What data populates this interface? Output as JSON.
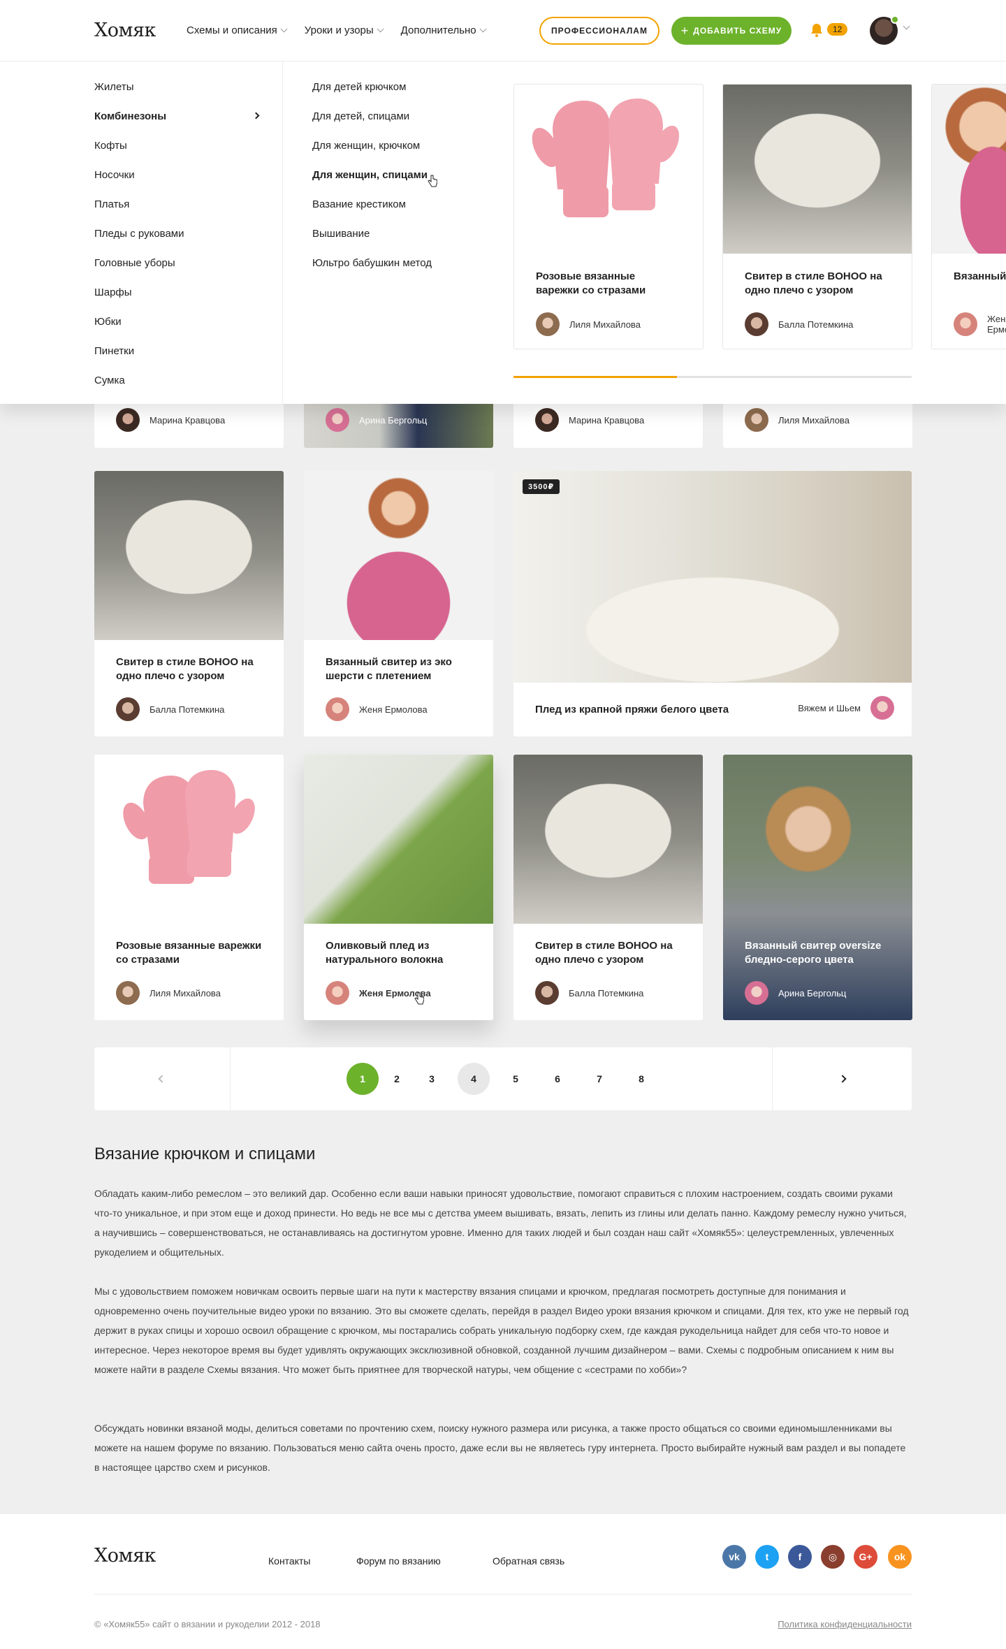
{
  "header": {
    "logo": "Хомяк",
    "nav": [
      "Схемы и описания",
      "Уроки и узоры",
      "Дополнительно"
    ],
    "btn_pro": "ПРОФЕССИОНАЛАМ",
    "btn_add": "ДОБАВИТЬ СХЕМУ",
    "notifications_count": "12"
  },
  "mega_menu": {
    "categories": [
      "Жилеты",
      "Комбинезоны",
      "Кофты",
      "Носочки",
      "Платья",
      "Пледы с руковами",
      "Головные уборы",
      "Шарфы",
      "Юбки",
      "Пинетки",
      "Сумка"
    ],
    "active_category": "Комбинезоны",
    "subcategories": [
      "Для детей крючком",
      "Для детей, спицами",
      "Для женщин, крючком",
      "Для женщин, спицами",
      "Вазание крестиком",
      "Вышивание",
      "Юльтро бабушкин метод"
    ],
    "active_subcategory": "Для женщин, спицами",
    "cards": [
      {
        "title": "Розовые вязанные варежки со стразами",
        "author": "Лиля Михайлова"
      },
      {
        "title": "Свитер в стиле BOHOO на одно плечо с узором",
        "author": "Балла Потемкина"
      },
      {
        "title": "Вязанный свитер из эко шерсти с",
        "author": "Женя Ермолова"
      }
    ],
    "scroll_progress": 0.41
  },
  "row1_authors": [
    "Марина Кравцова",
    "Арина Бергольц",
    "Марина Кравцова",
    "Лиля Михайлова"
  ],
  "row2": [
    {
      "title": "Свитер в стиле BOHOO на одно плечо с узором",
      "author": "Балла Потемкина"
    },
    {
      "title": "Вязанный свитер из эко шерсти с плетением",
      "author": "Женя Ермолова"
    },
    {
      "title": "Плед из крапной пряжи белого цвета",
      "author": "Вяжем и Шьем",
      "price": "3500₽"
    }
  ],
  "row3": [
    {
      "title": "Розовые вязанные варежки со стразами",
      "author": "Лиля Михайлова"
    },
    {
      "title": "Оливковый плед из натурального волокна",
      "author": "Женя Ермолова"
    },
    {
      "title": "Свитер в стиле BOHOO на одно плечо с узором",
      "author": "Балла Потемкина"
    },
    {
      "title": "Вязанный свитер oversize бледно-серого цвета",
      "author": "Арина Бергольц"
    }
  ],
  "pagination": {
    "pages": [
      "1",
      "2",
      "3",
      "4",
      "5",
      "6",
      "7",
      "8"
    ],
    "current": "1",
    "hovered": "4"
  },
  "seo": {
    "title": "Вязание крючком и спицами",
    "p1": "Обладать каким-либо ремеслом – это великий дар. Особенно если ваши навыки приносят удовольствие, помогают справиться с плохим настроением, создать своими руками что-то уникальное, и при этом еще и доход принести. Но ведь не все мы с детства умеем вышивать, вязать, лепить из глины или делать панно. Каждому ремеслу нужно учиться, а научившись – совершенствоваться, не останавливаясь на достигнутом уровне. Именно для таких людей и был создан наш сайт «Хомяк55»: целеустремленных, увлеченных рукоделием и общительных.",
    "p2": "Мы с удовольствием поможем новичкам освоить первые шаги на пути к мастерству вязания спицами и крючком, предлагая посмотреть доступные для понимания и одновременно очень поучительные видео уроки по вязанию. Это вы сможете сделать, перейдя в раздел Видео уроки вязания крючком и спицами. Для тех, кто уже не первый год держит в руках спицы и хорошо освоил обращение с крючком, мы постарались собрать уникальную подборку схем, где каждая рукодельница найдет для себя что-то новое и интересное. Через некоторое время вы будет удивлять окружающих эксклюзивной обновкой, созданной лучшим дизайнером – вами. Схемы с подробным описанием к ним вы можете найти в разделе Схемы вязания. Что может быть приятнее для творческой натуры, чем общение с «сестрами по хобби»?",
    "p3": "Обсуждать новинки вязаной моды, делиться советами по прочтению схем, поиску нужного размера или рисунка, а также просто общаться со своими единомышленниками вы можете на нашем форуме по вязанию. Пользоваться меню сайта очень просто, даже если вы не являетесь гуру интернета. Просто выбирайте нужный вам раздел и вы попадете в настоящее царство схем и рисунков."
  },
  "footer": {
    "logo": "Хомяк",
    "links": [
      "Контакты",
      "Форум по вязанию",
      "Обратная связь"
    ],
    "social": [
      {
        "name": "vk",
        "label": "vk",
        "color": "#4a76a8"
      },
      {
        "name": "twitter",
        "label": "t",
        "color": "#1da1f2"
      },
      {
        "name": "facebook",
        "label": "f",
        "color": "#3b5998"
      },
      {
        "name": "instagram",
        "label": "◎",
        "color": "#8a3f2e"
      },
      {
        "name": "google-plus",
        "label": "G+",
        "color": "#dd4b39"
      },
      {
        "name": "odnoklassniki",
        "label": "ok",
        "color": "#f7931e"
      }
    ],
    "copyright": "© «Хомяк55» сайт о вязании и рукоделии 2012 - 2018",
    "privacy": "Политика конфиденциальности"
  },
  "colors": {
    "accent_green": "#6db22b",
    "accent_orange": "#f2a300"
  }
}
